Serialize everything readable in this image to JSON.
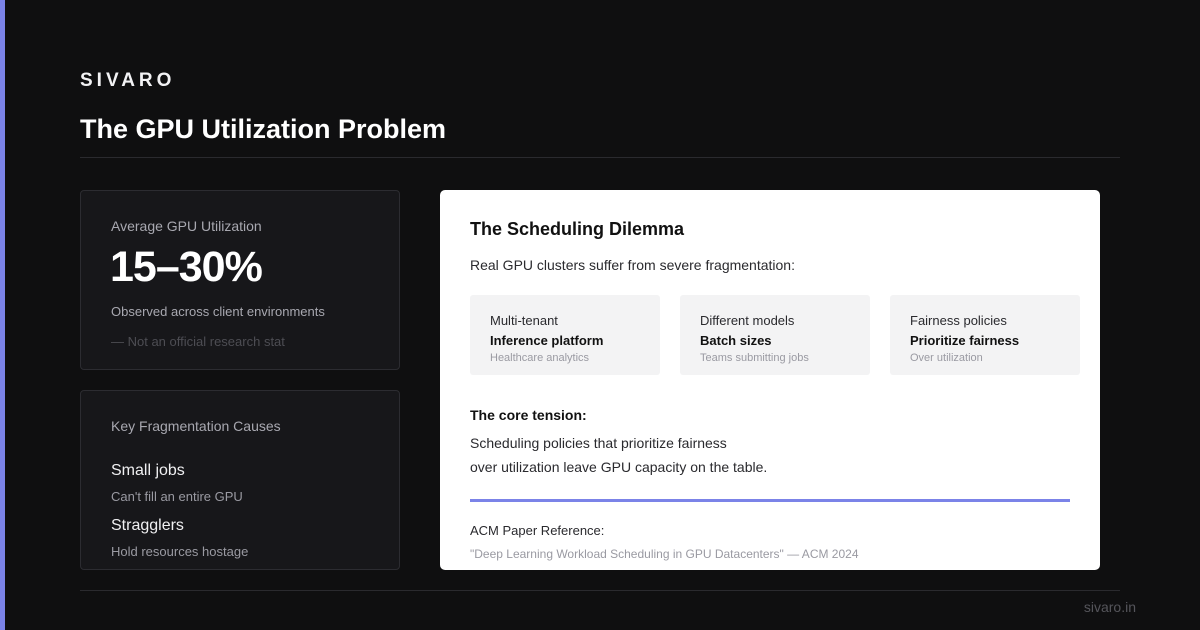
{
  "brand": "SIVARO",
  "title": "The GPU Utilization Problem",
  "utilization": {
    "label": "Average GPU Utilization",
    "value": "15–30%",
    "description": "Observed across client environments",
    "note": "— Not an official research stat"
  },
  "causes": {
    "label": "Key Fragmentation Causes",
    "items": [
      {
        "title": "Small jobs",
        "description": "Can't fill an entire GPU"
      },
      {
        "title": "Stragglers",
        "description": "Hold resources hostage"
      }
    ]
  },
  "dilemma": {
    "title": "The Scheduling Dilemma",
    "intro": "Real GPU clusters suffer from severe fragmentation:",
    "tiles": [
      {
        "heading": "Multi-tenant",
        "strong": "Inference platform",
        "sub": "Healthcare analytics"
      },
      {
        "heading": "Different models",
        "strong": "Batch sizes",
        "sub": "Teams submitting jobs"
      },
      {
        "heading": "Fairness policies",
        "strong": "Prioritize fairness",
        "sub": "Over utilization"
      }
    ],
    "tension_title": "The core tension:",
    "tension_line1": "Scheduling policies that prioritize fairness",
    "tension_line2": "over utilization leave GPU capacity on the table.",
    "reference_label": "ACM Paper Reference:",
    "reference_text": "\"Deep Learning Workload Scheduling in GPU Datacenters\" — ACM 2024"
  },
  "footer": {
    "url": "sivaro.in"
  },
  "colors": {
    "accent": "#7b83e8",
    "background": "#0f0f10",
    "card_dark": "#17171a",
    "card_light": "#ffffff"
  }
}
